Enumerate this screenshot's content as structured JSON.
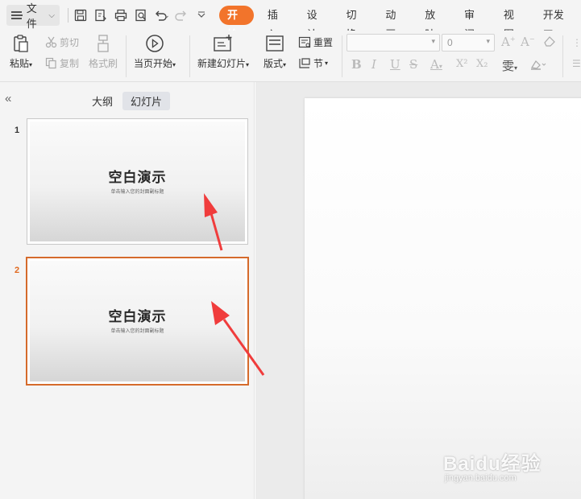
{
  "menu": {
    "file_label": "文件"
  },
  "tabs": [
    "开始",
    "插入",
    "设计",
    "切换",
    "动画",
    "放映",
    "审阅",
    "视图",
    "开发工"
  ],
  "ribbon": {
    "paste": "粘贴",
    "cut": "剪切",
    "copy": "复制",
    "format_painter": "格式刷",
    "play_from_current": "当页开始",
    "new_slide": "新建幻灯片",
    "layout": "版式",
    "reset": "重置",
    "section": "节",
    "font_size_value": "0",
    "superscript": "X²",
    "subscript": "X₂"
  },
  "left_panel": {
    "outline_tab": "大纲",
    "slides_tab": "幻灯片",
    "slides": [
      {
        "number": "1",
        "title": "空白演示",
        "subtitle": "单击输入您的封面副标题",
        "selected": false
      },
      {
        "number": "2",
        "title": "空白演示",
        "subtitle": "单击输入您的封面副标题",
        "selected": true
      }
    ]
  },
  "watermark": {
    "brand": "Baidu经验",
    "url": "jingyan.baidu.com"
  },
  "colors": {
    "accent": "#f2742b",
    "selection": "#d56a2b",
    "arrow": "#f03c3c"
  }
}
